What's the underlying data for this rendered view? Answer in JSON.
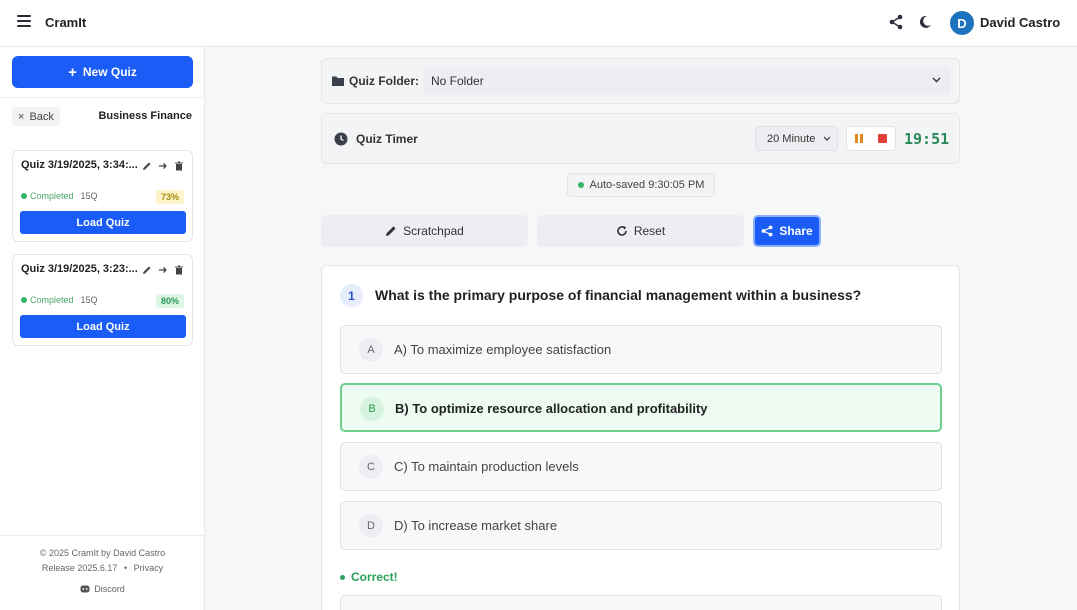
{
  "app": {
    "title": "CramIt"
  },
  "user": {
    "initial": "D",
    "name": "David Castro"
  },
  "sidebar": {
    "new_quiz_label": "New Quiz",
    "back_label": "Back",
    "folder_name": "Business Finance",
    "quizzes": [
      {
        "title": "Quiz 3/19/2025, 3:34:...",
        "status": "Completed",
        "questions": "15Q",
        "score": "73%"
      },
      {
        "title": "Quiz 3/19/2025, 3:23:...",
        "status": "Completed",
        "questions": "15Q",
        "score": "80%"
      }
    ],
    "load_label": "Load Quiz",
    "footer": {
      "copyright": "© 2025 CramIt by David Castro",
      "release": "Release 2025.6.17",
      "separator": "•",
      "privacy": "Privacy",
      "discord": "Discord"
    }
  },
  "main": {
    "folder_label": "Quiz Folder:",
    "folder_value": "No Folder",
    "timer_label": "Quiz Timer",
    "timer_duration": "20 Minute",
    "timer_time": "19:51",
    "autosave": "Auto-saved 9:30:05 PM",
    "actions": {
      "scratchpad": "Scratchpad",
      "reset": "Reset",
      "share": "Share"
    },
    "question": {
      "number": "1",
      "text": "What is the primary purpose of financial management within a business?",
      "options": [
        {
          "letter": "A",
          "text": "A) To maximize employee satisfaction"
        },
        {
          "letter": "B",
          "text": "B) To optimize resource allocation and profitability"
        },
        {
          "letter": "C",
          "text": "C) To maintain production levels"
        },
        {
          "letter": "D",
          "text": "D) To increase market share"
        }
      ],
      "feedback": "Correct!"
    }
  },
  "colors": {
    "primary": "#1a5cf5",
    "success": "#37b36a",
    "timer": "#2a8a5a"
  }
}
